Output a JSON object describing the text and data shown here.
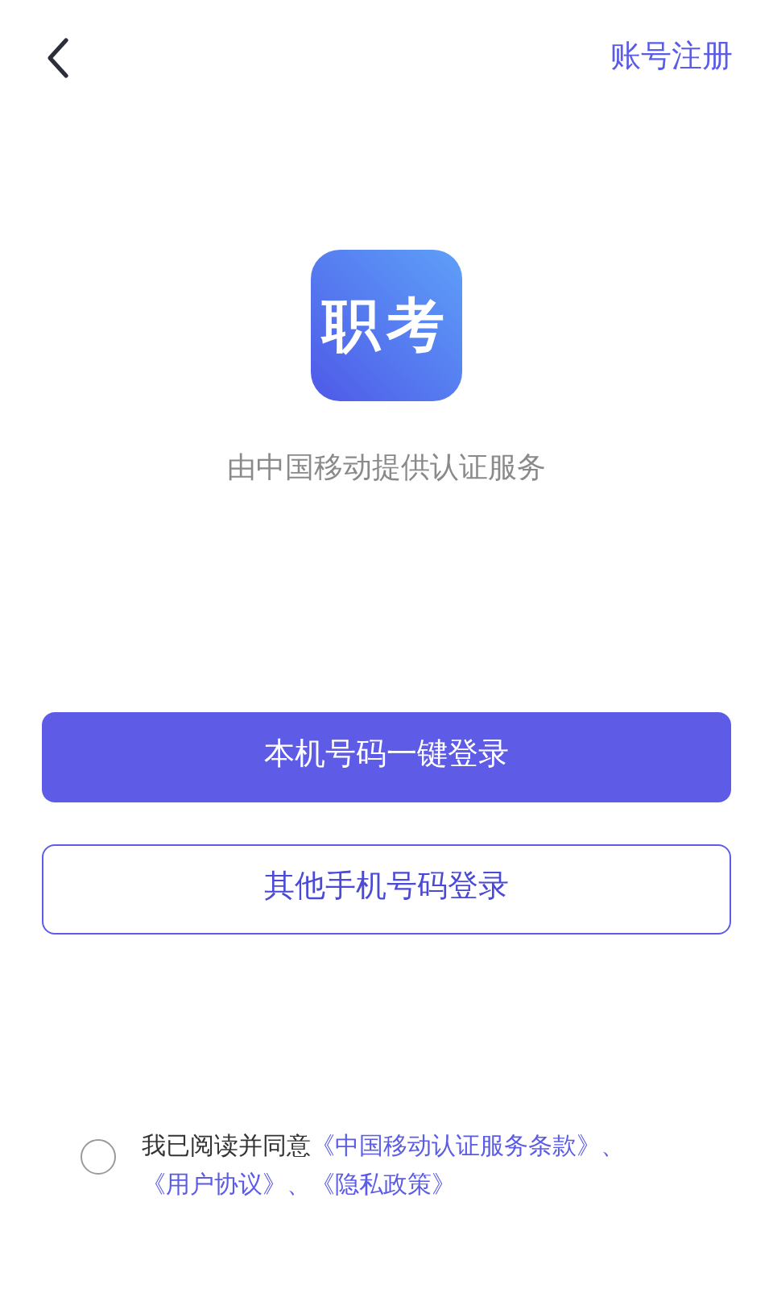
{
  "header": {
    "register_link": "账号注册"
  },
  "logo": {
    "text": "职考"
  },
  "provider_note": "由中国移动提供认证服务",
  "buttons": [
    {
      "label": "本机号码一键登录",
      "kind": "primary"
    },
    {
      "label": "其他手机号码登录",
      "kind": "outline"
    }
  ],
  "agreement": {
    "checked": false,
    "parts": [
      {
        "kind": "text",
        "text": "我已阅读并同意"
      },
      {
        "kind": "link",
        "text": "《中国移动认证服务条款》"
      },
      {
        "kind": "link",
        "text": "、"
      },
      {
        "kind": "link",
        "text": "《用户协议》"
      },
      {
        "kind": "link",
        "text": "、"
      },
      {
        "kind": "link",
        "text": "《隐私政策》"
      }
    ]
  }
}
